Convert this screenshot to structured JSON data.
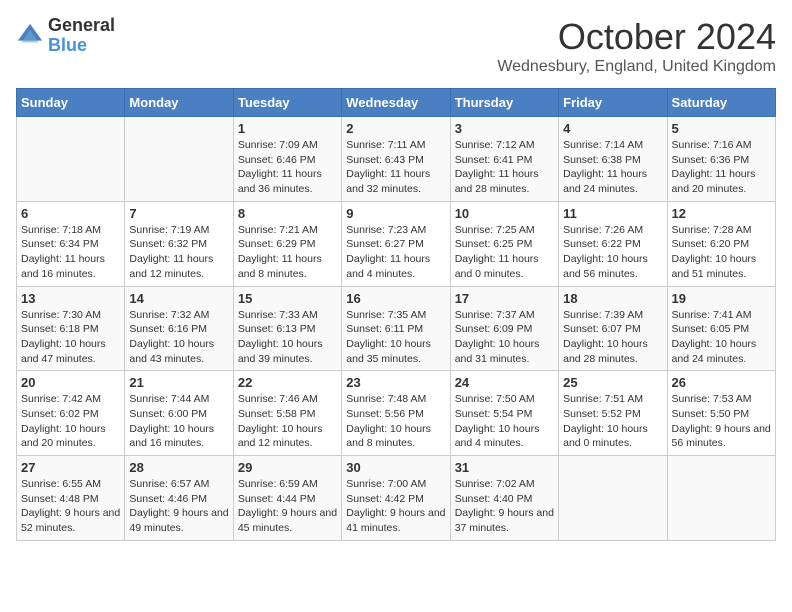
{
  "logo": {
    "general": "General",
    "blue": "Blue"
  },
  "header": {
    "month": "October 2024",
    "location": "Wednesbury, England, United Kingdom"
  },
  "days_of_week": [
    "Sunday",
    "Monday",
    "Tuesday",
    "Wednesday",
    "Thursday",
    "Friday",
    "Saturday"
  ],
  "weeks": [
    [
      {
        "day": "",
        "info": ""
      },
      {
        "day": "",
        "info": ""
      },
      {
        "day": "1",
        "info": "Sunrise: 7:09 AM\nSunset: 6:46 PM\nDaylight: 11 hours and 36 minutes."
      },
      {
        "day": "2",
        "info": "Sunrise: 7:11 AM\nSunset: 6:43 PM\nDaylight: 11 hours and 32 minutes."
      },
      {
        "day": "3",
        "info": "Sunrise: 7:12 AM\nSunset: 6:41 PM\nDaylight: 11 hours and 28 minutes."
      },
      {
        "day": "4",
        "info": "Sunrise: 7:14 AM\nSunset: 6:38 PM\nDaylight: 11 hours and 24 minutes."
      },
      {
        "day": "5",
        "info": "Sunrise: 7:16 AM\nSunset: 6:36 PM\nDaylight: 11 hours and 20 minutes."
      }
    ],
    [
      {
        "day": "6",
        "info": "Sunrise: 7:18 AM\nSunset: 6:34 PM\nDaylight: 11 hours and 16 minutes."
      },
      {
        "day": "7",
        "info": "Sunrise: 7:19 AM\nSunset: 6:32 PM\nDaylight: 11 hours and 12 minutes."
      },
      {
        "day": "8",
        "info": "Sunrise: 7:21 AM\nSunset: 6:29 PM\nDaylight: 11 hours and 8 minutes."
      },
      {
        "day": "9",
        "info": "Sunrise: 7:23 AM\nSunset: 6:27 PM\nDaylight: 11 hours and 4 minutes."
      },
      {
        "day": "10",
        "info": "Sunrise: 7:25 AM\nSunset: 6:25 PM\nDaylight: 11 hours and 0 minutes."
      },
      {
        "day": "11",
        "info": "Sunrise: 7:26 AM\nSunset: 6:22 PM\nDaylight: 10 hours and 56 minutes."
      },
      {
        "day": "12",
        "info": "Sunrise: 7:28 AM\nSunset: 6:20 PM\nDaylight: 10 hours and 51 minutes."
      }
    ],
    [
      {
        "day": "13",
        "info": "Sunrise: 7:30 AM\nSunset: 6:18 PM\nDaylight: 10 hours and 47 minutes."
      },
      {
        "day": "14",
        "info": "Sunrise: 7:32 AM\nSunset: 6:16 PM\nDaylight: 10 hours and 43 minutes."
      },
      {
        "day": "15",
        "info": "Sunrise: 7:33 AM\nSunset: 6:13 PM\nDaylight: 10 hours and 39 minutes."
      },
      {
        "day": "16",
        "info": "Sunrise: 7:35 AM\nSunset: 6:11 PM\nDaylight: 10 hours and 35 minutes."
      },
      {
        "day": "17",
        "info": "Sunrise: 7:37 AM\nSunset: 6:09 PM\nDaylight: 10 hours and 31 minutes."
      },
      {
        "day": "18",
        "info": "Sunrise: 7:39 AM\nSunset: 6:07 PM\nDaylight: 10 hours and 28 minutes."
      },
      {
        "day": "19",
        "info": "Sunrise: 7:41 AM\nSunset: 6:05 PM\nDaylight: 10 hours and 24 minutes."
      }
    ],
    [
      {
        "day": "20",
        "info": "Sunrise: 7:42 AM\nSunset: 6:02 PM\nDaylight: 10 hours and 20 minutes."
      },
      {
        "day": "21",
        "info": "Sunrise: 7:44 AM\nSunset: 6:00 PM\nDaylight: 10 hours and 16 minutes."
      },
      {
        "day": "22",
        "info": "Sunrise: 7:46 AM\nSunset: 5:58 PM\nDaylight: 10 hours and 12 minutes."
      },
      {
        "day": "23",
        "info": "Sunrise: 7:48 AM\nSunset: 5:56 PM\nDaylight: 10 hours and 8 minutes."
      },
      {
        "day": "24",
        "info": "Sunrise: 7:50 AM\nSunset: 5:54 PM\nDaylight: 10 hours and 4 minutes."
      },
      {
        "day": "25",
        "info": "Sunrise: 7:51 AM\nSunset: 5:52 PM\nDaylight: 10 hours and 0 minutes."
      },
      {
        "day": "26",
        "info": "Sunrise: 7:53 AM\nSunset: 5:50 PM\nDaylight: 9 hours and 56 minutes."
      }
    ],
    [
      {
        "day": "27",
        "info": "Sunrise: 6:55 AM\nSunset: 4:48 PM\nDaylight: 9 hours and 52 minutes."
      },
      {
        "day": "28",
        "info": "Sunrise: 6:57 AM\nSunset: 4:46 PM\nDaylight: 9 hours and 49 minutes."
      },
      {
        "day": "29",
        "info": "Sunrise: 6:59 AM\nSunset: 4:44 PM\nDaylight: 9 hours and 45 minutes."
      },
      {
        "day": "30",
        "info": "Sunrise: 7:00 AM\nSunset: 4:42 PM\nDaylight: 9 hours and 41 minutes."
      },
      {
        "day": "31",
        "info": "Sunrise: 7:02 AM\nSunset: 4:40 PM\nDaylight: 9 hours and 37 minutes."
      },
      {
        "day": "",
        "info": ""
      },
      {
        "day": "",
        "info": ""
      }
    ]
  ]
}
